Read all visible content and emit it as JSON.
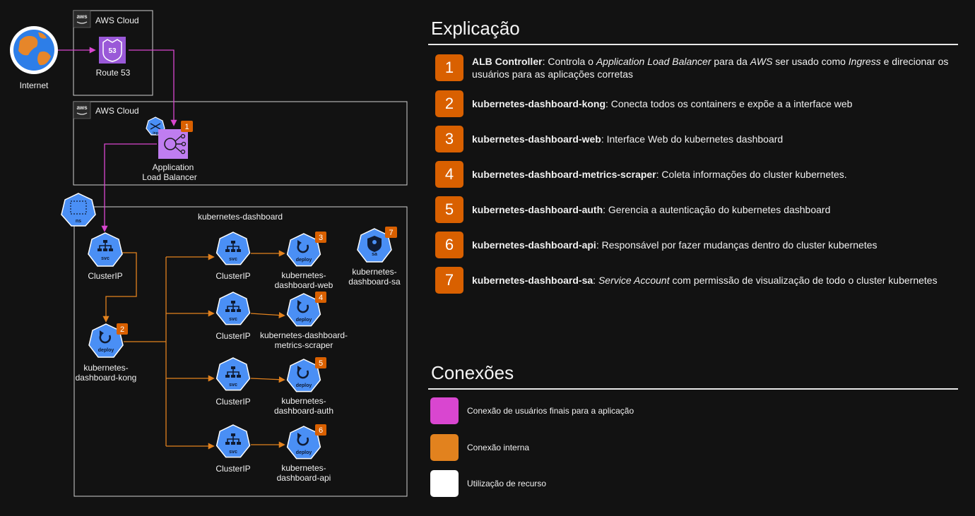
{
  "colors": {
    "background": "#121212",
    "user_connection": "#d946d0",
    "internal_connection": "#e2821e",
    "resource_usage": "#ffffff",
    "k8s_blue": "#4a8ff5",
    "badge": "#d96000",
    "alb_purple": "#bf7df0"
  },
  "diagram": {
    "internet": {
      "label": "Internet",
      "icon": "globe-icon"
    },
    "aws_group_1": {
      "label": "AWS Cloud",
      "icon": "aws-logo-icon"
    },
    "route53": {
      "label": "Route 53",
      "icon_text": "53",
      "icon": "route53-icon"
    },
    "aws_group_2": {
      "label": "AWS Cloud",
      "icon": "aws-logo-icon"
    },
    "ing": {
      "icon_text": "ing",
      "icon": "ingress-icon"
    },
    "alb": {
      "label_line1": "Application",
      "label_line2": "Load Balancer",
      "badge": "1",
      "icon": "load-balancer-icon"
    },
    "ns": {
      "icon_text": "ns",
      "icon": "namespace-icon"
    },
    "namespace_label": "kubernetes-dashboard",
    "svc_main": {
      "icon_text": "svc",
      "label": "ClusterIP"
    },
    "kong": {
      "icon_text": "deploy",
      "label_line1": "kubernetes-",
      "label_line2": "dashboard-kong",
      "badge": "2"
    },
    "sa": {
      "icon_text": "sa",
      "label_line1": "kubernetes-",
      "label_line2": "dashboard-sa",
      "badge": "7"
    },
    "rows": [
      {
        "svc_text": "svc",
        "svc_label": "ClusterIP",
        "deploy_text": "deploy",
        "badge": "3",
        "label_line1": "kubernetes-",
        "label_line2": "dashboard-web"
      },
      {
        "svc_text": "svc",
        "svc_label": "ClusterIP",
        "deploy_text": "deploy",
        "badge": "4",
        "label_line1": "kubernetes-dashboard-",
        "label_line2": "metrics-scraper"
      },
      {
        "svc_text": "svc",
        "svc_label": "ClusterIP",
        "deploy_text": "deploy",
        "badge": "5",
        "label_line1": "kubernetes-",
        "label_line2": "dashboard-auth"
      },
      {
        "svc_text": "svc",
        "svc_label": "ClusterIP",
        "deploy_text": "deploy",
        "badge": "6",
        "label_line1": "kubernetes-",
        "label_line2": "dashboard-api"
      }
    ]
  },
  "explicacao": {
    "title": "Explicação",
    "items": [
      {
        "num": "1",
        "name": "ALB Controller",
        "text": ": Controla o <i>Application Load Balancer</i> para da <i>AWS</i> ser usado como <i>Ingress</i> e direcionar os usuários para as aplicações corretas"
      },
      {
        "num": "2",
        "name": "kubernetes-dashboard-kong",
        "text": ": Conecta todos os containers e expõe a a interface web"
      },
      {
        "num": "3",
        "name": "kubernetes-dashboard-web",
        "text": ": Interface Web do kubernetes dashboard"
      },
      {
        "num": "4",
        "name": "kubernetes-dashboard-metrics-scraper",
        "text": ": Coleta informações do cluster kubernetes."
      },
      {
        "num": "5",
        "name": "kubernetes-dashboard-auth",
        "text": ": Gerencia a autenticação do kubernetes dashboard"
      },
      {
        "num": "6",
        "name": "kubernetes-dashboard-api",
        "text": ": Responsável por fazer mudanças dentro do cluster kubernetes"
      },
      {
        "num": "7",
        "name": "kubernetes-dashboard-sa",
        "text": ": <i>Service Account</i> com permissão de visualização de todo o cluster kubernetes"
      }
    ]
  },
  "conexoes": {
    "title": "Conexões",
    "items": [
      {
        "color": "#d946d0",
        "label": "Conexão de usuários finais para a aplicação"
      },
      {
        "color": "#e2821e",
        "label": "Conexão interna"
      },
      {
        "color": "#ffffff",
        "label": "Utilização de recurso"
      }
    ]
  }
}
